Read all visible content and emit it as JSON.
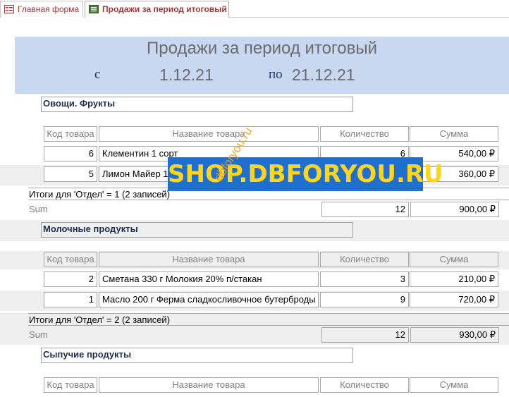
{
  "tabs": [
    {
      "label": "Главная форма",
      "icon": "form-icon",
      "active": false
    },
    {
      "label": "Продажи за период итоговый",
      "icon": "report-icon",
      "active": true
    }
  ],
  "report": {
    "title": "Продажи за период итоговый",
    "from_label": "с",
    "from_date": "1.12.21",
    "to_label": "по",
    "to_date": "21.12.21"
  },
  "columns": {
    "code": "Код товара",
    "name": "Название товара",
    "qty": "Количество",
    "sum": "Сумма"
  },
  "groups": [
    {
      "name": "Овощи. Фрукты",
      "rows": [
        {
          "code": "6",
          "name": "Клементин 1 сорт",
          "qty": "6",
          "sum": "540,00 ₽"
        },
        {
          "code": "5",
          "name": "Лимон Майер 1",
          "qty": "",
          "sum": "360,00 ₽"
        }
      ],
      "totals_label": "Итоги для 'Отдел' =  1 (2 записей)",
      "sum_label": "Sum",
      "total_qty": "12",
      "total_sum": "900,00 ₽"
    },
    {
      "name": "Молочные продукты",
      "rows": [
        {
          "code": "2",
          "name": "Сметана 330 г Молокия 20% п/стакан",
          "qty": "3",
          "sum": "210,00 ₽"
        },
        {
          "code": "1",
          "name": "Масло 200 г Ферма сладкосливочное бутерброды",
          "qty": "9",
          "sum": "720,00 ₽"
        }
      ],
      "totals_label": "Итоги для 'Отдел' =  2 (2 записей)",
      "sum_label": "Sum",
      "total_qty": "12",
      "total_sum": "930,00 ₽"
    },
    {
      "name": "Сыпучие продукты"
    }
  ],
  "watermark": {
    "banner": "SHOP.DBFORYOU.RU",
    "diagonal": "dbforyou.ru",
    "colors": {
      "banner_bg": "#1e6fd0",
      "banner_text": "#ffd51a",
      "diagonal": "#f0a020"
    }
  },
  "colors": {
    "header_band": "#c7d8f0",
    "row_band": "#efefef",
    "tab_text": "#a4373a"
  }
}
